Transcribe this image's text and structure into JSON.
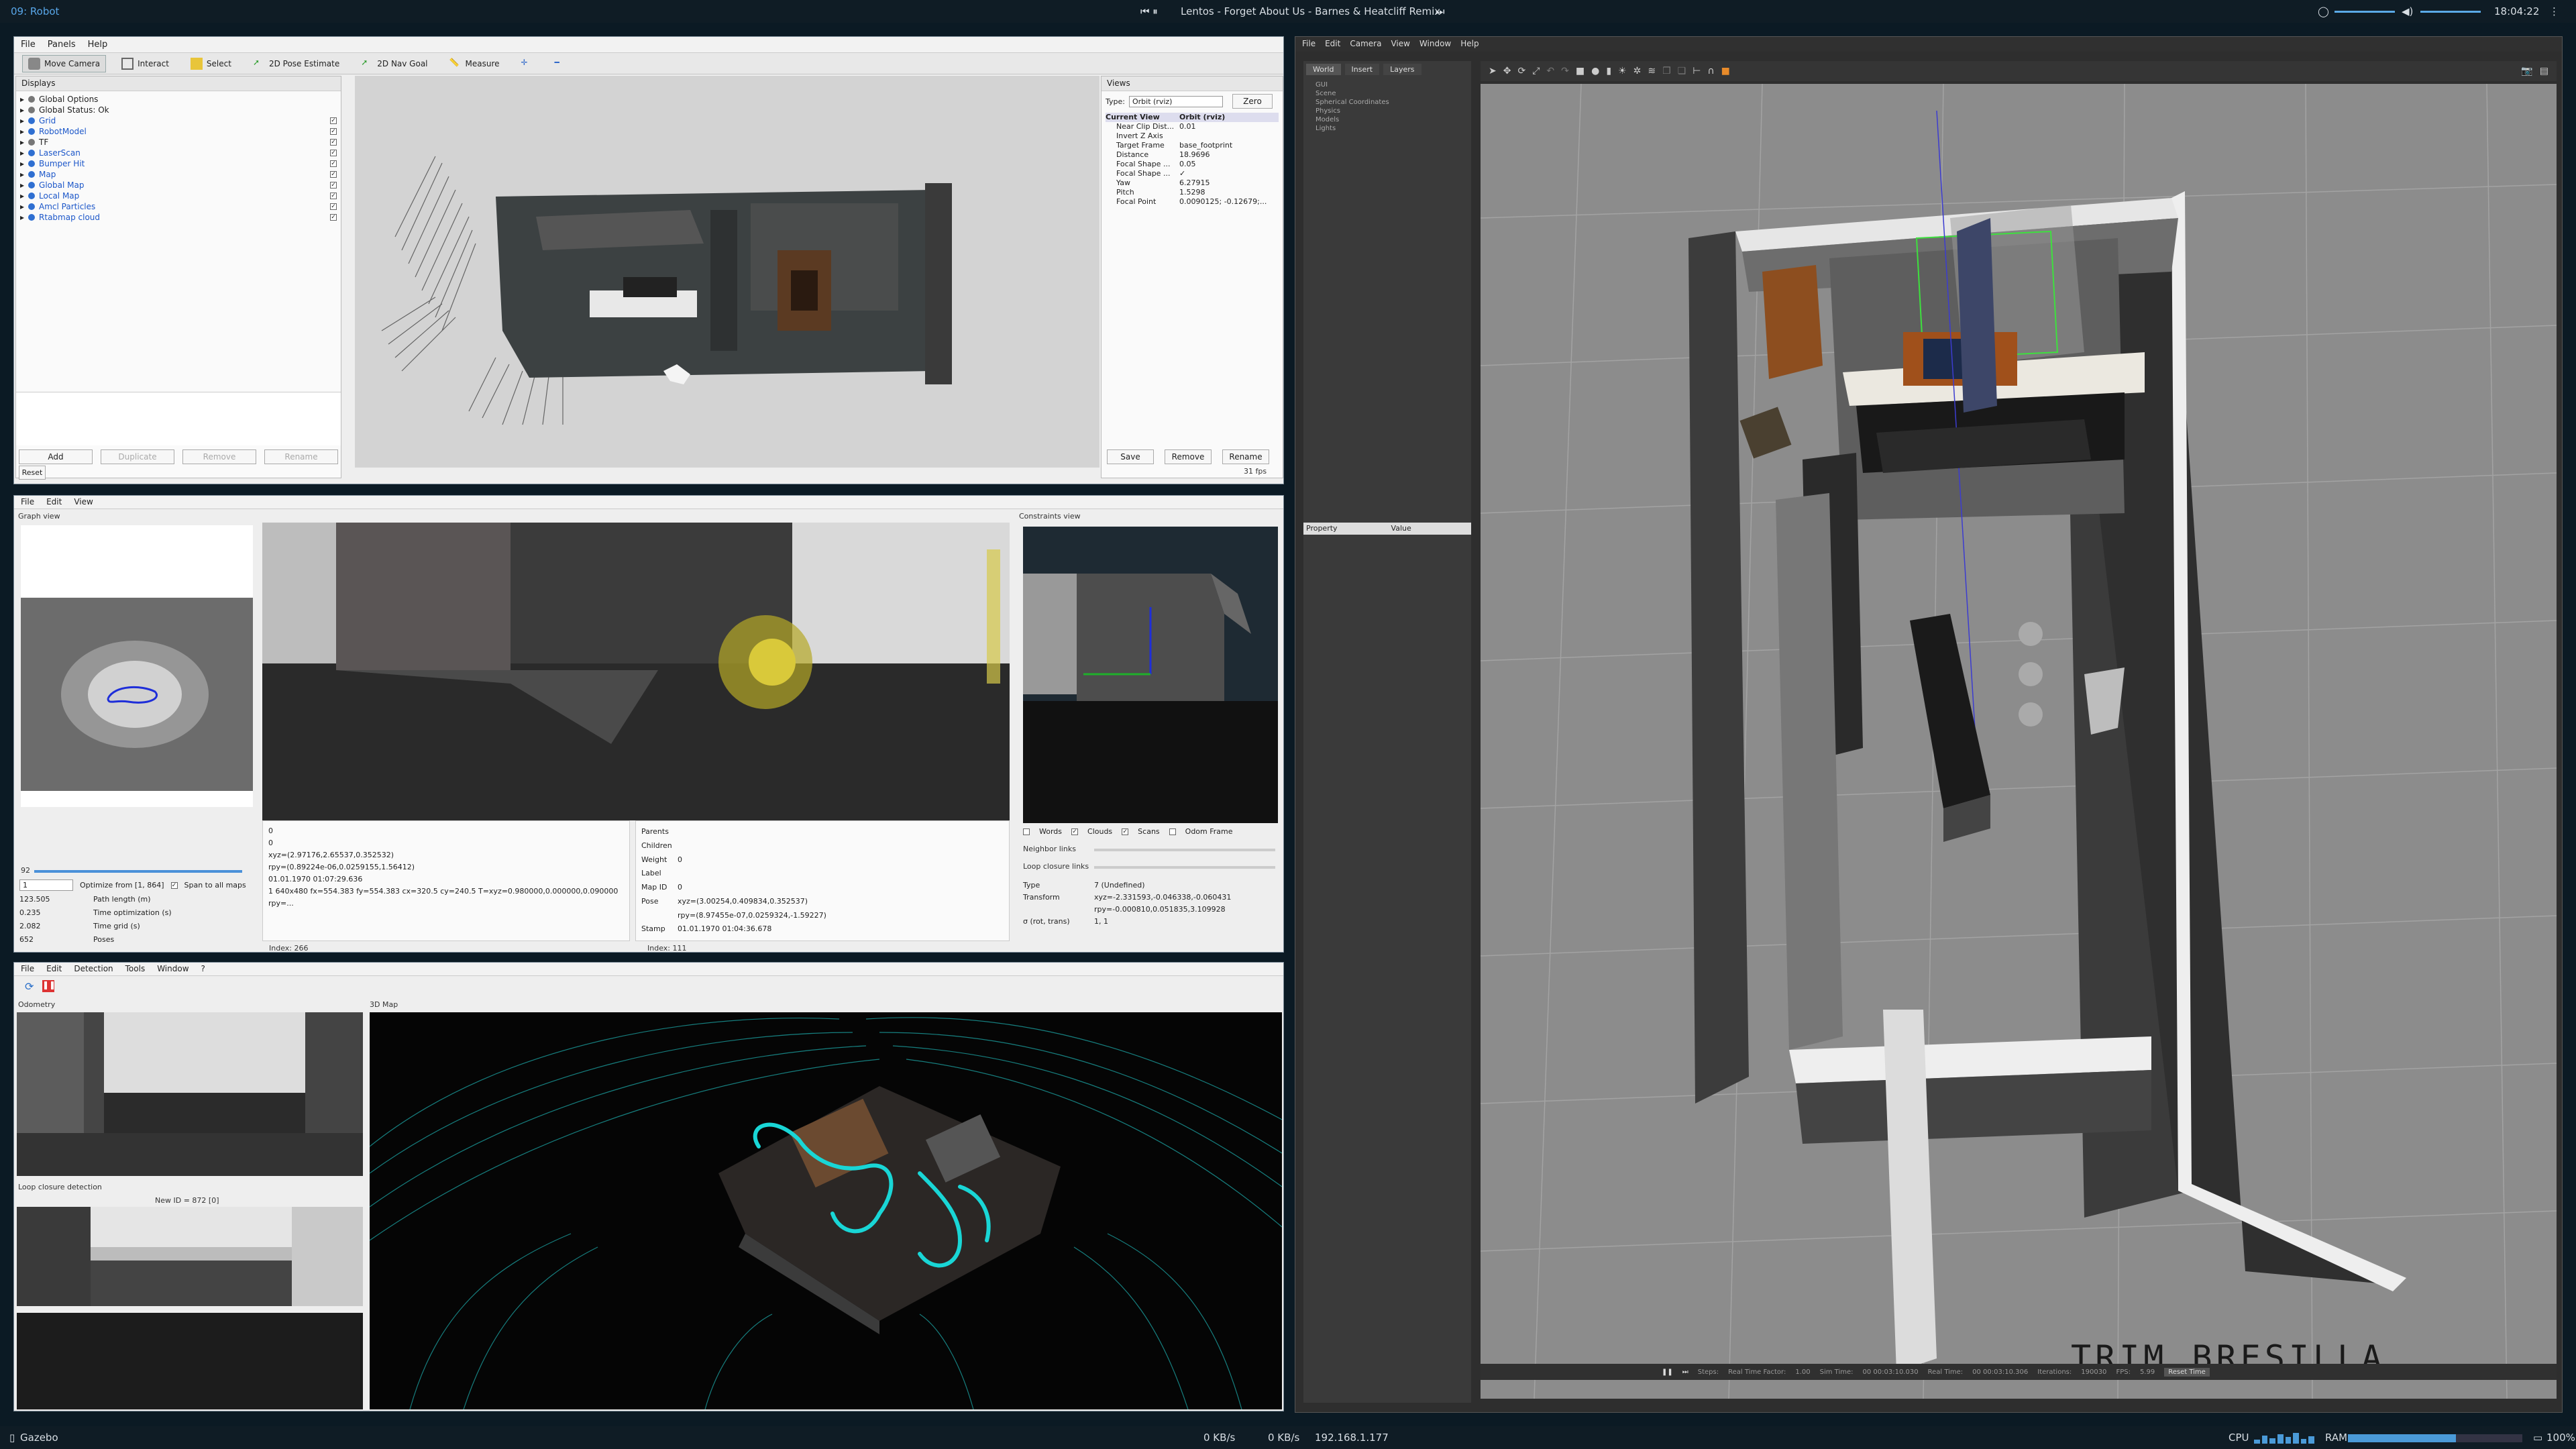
{
  "topbar": {
    "workspace": "09: Robot",
    "media": "Lentos - Forget About Us - Barnes & Heatcliff Remix",
    "clock": "18:04:22"
  },
  "bottombar": {
    "app": "Gazebo",
    "down": "0 KB/s",
    "up": "0 KB/s",
    "ip": "192.168.1.177",
    "cpu": "CPU",
    "ram": "RAM",
    "battery": "100%"
  },
  "rviz": {
    "menu": [
      "File",
      "Panels",
      "Help"
    ],
    "tools": [
      "Move Camera",
      "Interact",
      "Select",
      "2D Pose Estimate",
      "2D Nav Goal",
      "Measure"
    ],
    "displays_title": "Displays",
    "displays": [
      {
        "label": "Global Options",
        "blue": false,
        "check": false
      },
      {
        "label": "Global Status: Ok",
        "blue": false,
        "check": false
      },
      {
        "label": "Grid",
        "blue": true,
        "check": true
      },
      {
        "label": "RobotModel",
        "blue": true,
        "check": true
      },
      {
        "label": "TF",
        "blue": false,
        "check": true
      },
      {
        "label": "LaserScan",
        "blue": true,
        "check": true
      },
      {
        "label": "Bumper Hit",
        "blue": true,
        "check": true
      },
      {
        "label": "Map",
        "blue": true,
        "check": true
      },
      {
        "label": "Global Map",
        "blue": true,
        "check": true
      },
      {
        "label": "Local Map",
        "blue": true,
        "check": true
      },
      {
        "label": "Amcl Particles",
        "blue": true,
        "check": true
      },
      {
        "label": "Rtabmap cloud",
        "blue": true,
        "check": true
      }
    ],
    "buttons": {
      "add": "Add",
      "duplicate": "Duplicate",
      "remove": "Remove",
      "rename": "Rename",
      "reset": "Reset"
    },
    "views": {
      "title": "Views",
      "type_label": "Type:",
      "type_value": "Orbit (rviz)",
      "zero": "Zero",
      "header": {
        "k": "Current View",
        "v": "Orbit (rviz)"
      },
      "rows": [
        {
          "k": "Near Clip Dist...",
          "v": "0.01"
        },
        {
          "k": "Invert Z Axis",
          "v": ""
        },
        {
          "k": "Target Frame",
          "v": "base_footprint"
        },
        {
          "k": "Distance",
          "v": "18.9696"
        },
        {
          "k": "Focal Shape ...",
          "v": "0.05"
        },
        {
          "k": "Focal Shape ...",
          "v": "✓"
        },
        {
          "k": "Yaw",
          "v": "6.27915"
        },
        {
          "k": "Pitch",
          "v": "1.5298"
        },
        {
          "k": "Focal Point",
          "v": "0.0090125; -0.12679;..."
        }
      ],
      "save": "Save",
      "remove": "Remove",
      "rename": "Rename"
    },
    "fps": "31 fps"
  },
  "rtabmap": {
    "menu": [
      "File",
      "Edit",
      "View"
    ],
    "graph_title": "Graph view",
    "graph_val": "92",
    "optimize_from": "1",
    "optimize_label": "Optimize from [1, 864]",
    "span_label": "Span to all maps",
    "stats": [
      {
        "v": "123.505",
        "k": "Path length (m)"
      },
      {
        "v": "0.235",
        "k": "Time optimization (s)"
      },
      {
        "v": "2.082",
        "k": "Time grid (s)"
      },
      {
        "v": "652",
        "k": "Poses"
      }
    ],
    "info_left": [
      "0",
      "0",
      "xyz=(2.97176,2.65537,0.352532)",
      "rpy=(0.89224e-06,0.0259155,1.56412)",
      "01.01.1970 01:07:29.636",
      "1 640x480 fx=554.383 fy=554.383 cx=320.5 cy=240.5 T=xyz=0.980000,0.000000,0.090000 rpy=..."
    ],
    "index_left": "Index: 266",
    "info_right_keys": [
      "Parents",
      "Children",
      "Weight",
      "Label",
      "Map ID",
      "Pose",
      "",
      "Stamp"
    ],
    "info_right_vals": [
      "",
      "",
      "0",
      "",
      "0",
      "xyz=(3.00254,0.409834,0.352537)",
      "rpy=(8.97455e-07,0.0259324,-1.59227)",
      "01.01.1970 01:04:36.678"
    ],
    "index_right": "Index: 111",
    "constraints_title": "Constraints view",
    "checks": [
      "Words",
      "Clouds",
      "Scans",
      "Odom Frame"
    ],
    "neighbor": "Neighbor links",
    "loop": "Loop closure links",
    "type_k": "Type",
    "type_v": "7 (Undefined)",
    "transform_k": "Transform",
    "transform_v": "xyz=-2.331593,-0.046338,-0.060431",
    "transform_v2": "rpy=-0.000810,0.051835,3.109928",
    "sigma_k": "σ (rot, trans)",
    "sigma_v": "1, 1"
  },
  "odom": {
    "menu": [
      "File",
      "Edit",
      "Detection",
      "Tools",
      "Window",
      "?"
    ],
    "odom_title": "Odometry",
    "map_title": "3D Map",
    "loop_title": "Loop closure detection",
    "new_id": "New ID = 872 [0]"
  },
  "gazebo": {
    "menu": [
      "File",
      "Edit",
      "Camera",
      "View",
      "Window",
      "Help"
    ],
    "tabs": [
      "World",
      "Insert",
      "Layers"
    ],
    "tree": [
      "GUI",
      "Scene",
      "Spherical Coordinates",
      "Physics",
      "Models",
      "Lights"
    ],
    "prop": "Property",
    "value": "Value",
    "watermark": "TRIM BRESILLA",
    "status": {
      "steps": "Steps:",
      "rtf_k": "Real Time Factor:",
      "rtf_v": "1.00",
      "sim_k": "Sim Time:",
      "sim_v": "00 00:03:10.030",
      "real_k": "Real Time:",
      "real_v": "00 00:03:10.306",
      "iter_k": "Iterations:",
      "iter_v": "190030",
      "fps_k": "FPS:",
      "fps_v": "5.99",
      "reset": "Reset Time"
    }
  }
}
